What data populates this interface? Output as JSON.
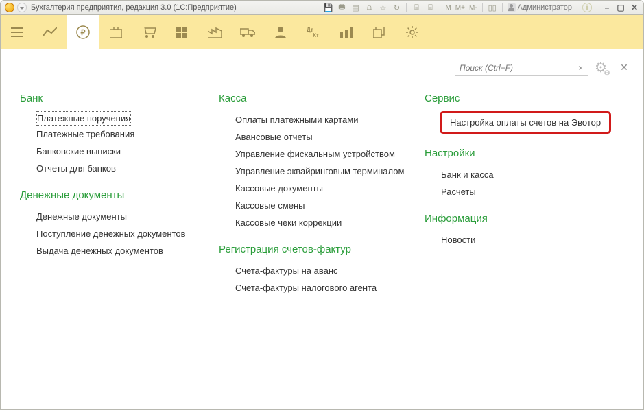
{
  "titlebar": {
    "title": "Бухгалтерия предприятия, редакция 3.0  (1С:Предприятие)",
    "mem_m": "M",
    "mem_mplus": "M+",
    "mem_mminus": "M-",
    "user_label": "Администратор"
  },
  "search": {
    "placeholder": "Поиск (Ctrl+F)",
    "clear": "×"
  },
  "sections": {
    "bank": {
      "title": "Банк",
      "items": [
        "Платежные поручения",
        "Платежные требования",
        "Банковские выписки",
        "Отчеты для банков"
      ]
    },
    "money_docs": {
      "title": "Денежные документы",
      "items": [
        "Денежные документы",
        "Поступление денежных документов",
        "Выдача денежных документов"
      ]
    },
    "kassa": {
      "title": "Касса",
      "items": [
        "Оплаты платежными картами",
        "Авансовые отчеты",
        "Управление фискальным устройством",
        "Управление эквайринговым терминалом",
        "Кассовые документы",
        "Кассовые смены",
        "Кассовые чеки коррекции"
      ]
    },
    "reg_invoice": {
      "title": "Регистрация счетов-фактур",
      "items": [
        "Счета-фактуры на аванс",
        "Счета-фактуры налогового агента"
      ]
    },
    "service": {
      "title": "Сервис",
      "highlight": "Настройка оплаты счетов на Эвотор"
    },
    "settings": {
      "title": "Настройки",
      "items": [
        "Банк и касса",
        "Расчеты"
      ]
    },
    "info": {
      "title": "Информация",
      "items": [
        "Новости"
      ]
    }
  }
}
